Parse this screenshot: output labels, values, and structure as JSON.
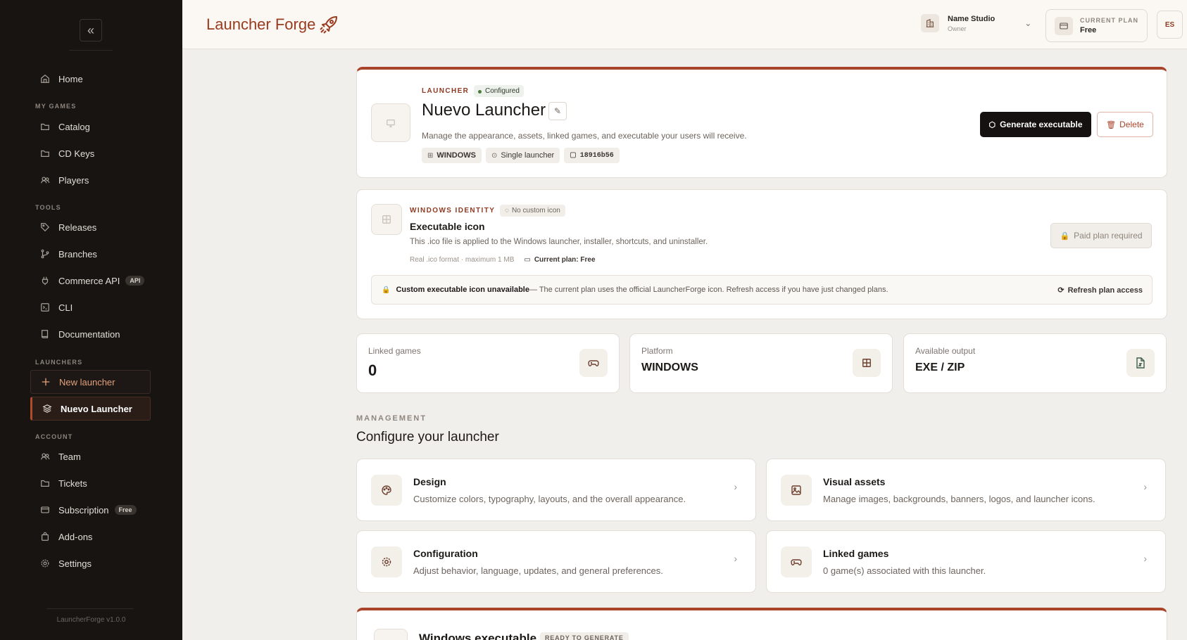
{
  "sidebar": {
    "collapse_icon": "chevrons-left-icon",
    "home": "Home",
    "sections": {
      "my_games": "MY GAMES",
      "tools": "TOOLS",
      "launchers": "LAUNCHERS",
      "account": "ACCOUNT"
    },
    "my_games": [
      "Catalog",
      "CD Keys",
      "Players"
    ],
    "tools": [
      "Releases",
      "Branches",
      "Commerce API",
      "CLI",
      "Documentation"
    ],
    "commerce_badge": "API",
    "new_launcher": "New launcher",
    "active_launcher": "Nuevo Launcher",
    "account": [
      "Team",
      "Tickets",
      "Subscription",
      "Add-ons",
      "Settings"
    ],
    "subscription_badge": "Free",
    "version": "LauncherForge v1.0.0"
  },
  "header": {
    "logo": "Launcher Forge",
    "studio_name": "Name Studio",
    "studio_role": "Owner",
    "plan_label": "CURRENT PLAN",
    "plan_value": "Free",
    "avatar_initials": "ES"
  },
  "launcher": {
    "eyebrow": "LAUNCHER",
    "status": "Configured",
    "title": "Nuevo Launcher",
    "description": "Manage the appearance, assets, linked games, and executable your users will receive.",
    "chips": [
      "WINDOWS",
      "Single launcher",
      "18916b56"
    ],
    "generate_label": "Generate executable",
    "delete_label": "Delete"
  },
  "identity": {
    "eyebrow": "WINDOWS IDENTITY",
    "badge": "No custom icon",
    "title": "Executable icon",
    "description": "This .ico file is applied to the Windows launcher, installer, shortcuts, and uninstaller.",
    "format": "Real .ico format · maximum 1 MB",
    "current_plan": "Current plan: Free",
    "paid_button": "Paid plan required",
    "notice_title": "Custom executable icon unavailable",
    "notice_text": " — The current plan uses the official LauncherForge icon. Refresh access if you have just changed plans.",
    "refresh_label": "Refresh plan access"
  },
  "stats": [
    {
      "label": "Linked games",
      "value": "0",
      "icon": "gamepad-icon"
    },
    {
      "label": "Platform",
      "value": "WINDOWS",
      "icon": "windows-icon"
    },
    {
      "label": "Available output",
      "value": "EXE / ZIP",
      "icon": "zip-file-icon"
    }
  ],
  "management": {
    "eyebrow": "MANAGEMENT",
    "title": "Configure your launcher",
    "tiles": [
      {
        "title": "Design",
        "subtitle": "Customize colors, typography, layouts, and the overall appearance.",
        "icon": "palette-icon"
      },
      {
        "title": "Visual assets",
        "subtitle": "Manage images, backgrounds, banners, logos, and launcher icons.",
        "icon": "image-icon"
      },
      {
        "title": "Configuration",
        "subtitle": "Adjust behavior, language, updates, and general preferences.",
        "icon": "gear-icon"
      },
      {
        "title": "Linked games",
        "subtitle": "0 game(s) associated with this launcher.",
        "icon": "gamepad-icon"
      }
    ]
  },
  "executable": {
    "title": "Windows executable",
    "badge": "READY TO GENERATE"
  },
  "colors": {
    "accent": "#a9442a",
    "sidebar_bg": "#171412",
    "page_bg": "#f1efeb"
  }
}
